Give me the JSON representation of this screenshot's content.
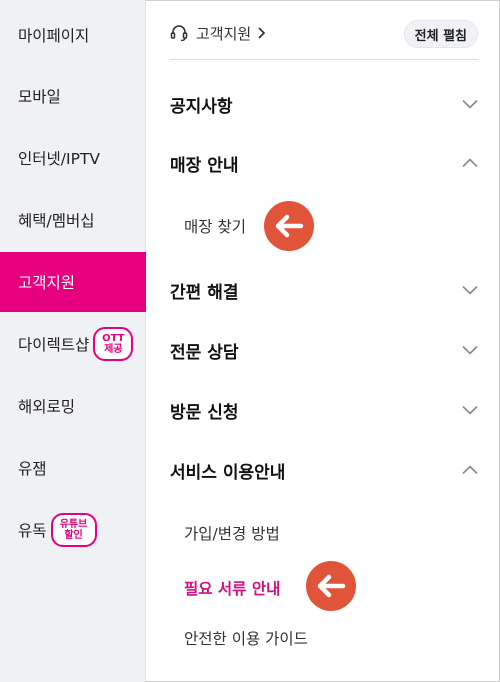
{
  "sidebar": {
    "items": [
      {
        "label": "마이페이지"
      },
      {
        "label": "모바일"
      },
      {
        "label": "인터넷/IPTV"
      },
      {
        "label": "혜택/멤버십"
      },
      {
        "label": "고객지원",
        "active": true
      },
      {
        "label": "다이렉트샵",
        "badge": [
          "OTT",
          "제공"
        ]
      },
      {
        "label": "해외로밍"
      },
      {
        "label": "유잼"
      },
      {
        "label": "유독",
        "badge": [
          "유튜브",
          "할인"
        ]
      }
    ]
  },
  "header": {
    "breadcrumb": "고객지원",
    "breadcrumb_icon": "headset-icon",
    "expand_all": "전체 펼침"
  },
  "sections": [
    {
      "title": "공지사항",
      "expanded": false
    },
    {
      "title": "매장 안내",
      "expanded": true,
      "items": [
        {
          "label": "매장 찾기"
        }
      ]
    },
    {
      "title": "간편 해결",
      "expanded": false
    },
    {
      "title": "전문 상담",
      "expanded": false
    },
    {
      "title": "방문 신청",
      "expanded": false
    },
    {
      "title": "서비스 이용안내",
      "expanded": true,
      "items": [
        {
          "label": "가입/변경 방법"
        },
        {
          "label": "필요 서류 안내",
          "highlighted": true
        },
        {
          "label": "안전한 이용 가이드"
        }
      ]
    }
  ],
  "colors": {
    "accent": "#e6007e",
    "highlight_text": "#d0107e",
    "arrow": "#e0553a",
    "sidebar_bg": "#f0f1f5"
  }
}
